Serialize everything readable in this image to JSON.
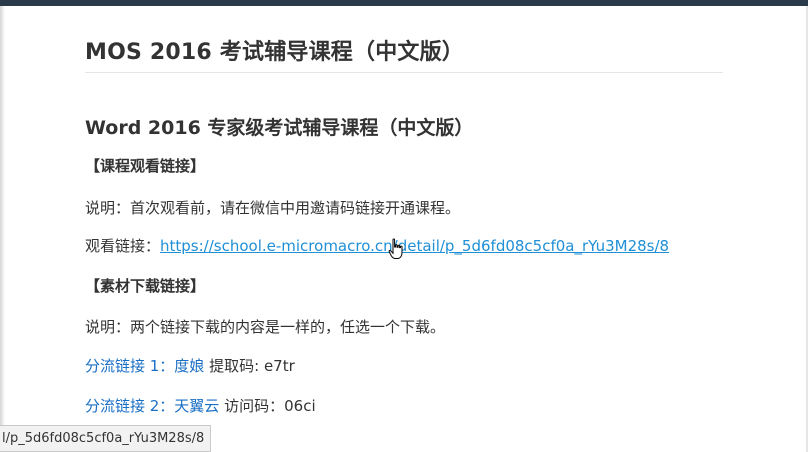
{
  "page": {
    "title": "MOS 2016 考试辅导课程（中文版）"
  },
  "section": {
    "heading": "Word 2016 专家级考试辅导课程（中文版）",
    "watch": {
      "heading": "【课程观看链接】",
      "note": "说明：首次观看前，请在微信中用邀请码链接开通课程。",
      "link_label": "观看链接：",
      "link_url": "https://school.e-micromacro.cn/detail/p_5d6fd08c5cf0a_rYu3M28s/8"
    },
    "download": {
      "heading": "【素材下载链接】",
      "note": "说明：两个链接下载的内容是一样的，任选一个下载。",
      "mirrors": [
        {
          "link_text": "分流链接 1：度娘",
          "code_label": "提取码:",
          "code": "e7tr"
        },
        {
          "link_text": "分流链接 2：天翼云",
          "code_label": "访问码：",
          "code": "06ci"
        }
      ]
    }
  },
  "status_bar": {
    "url_text": "l/p_5d6fd08c5cf0a_rYu3M28s/8"
  },
  "colors": {
    "link_underlined": "#1f8fd6",
    "link_plain": "#1a6fc4",
    "text": "#333333"
  },
  "icons": {
    "cursor": "hand-pointer-icon"
  }
}
